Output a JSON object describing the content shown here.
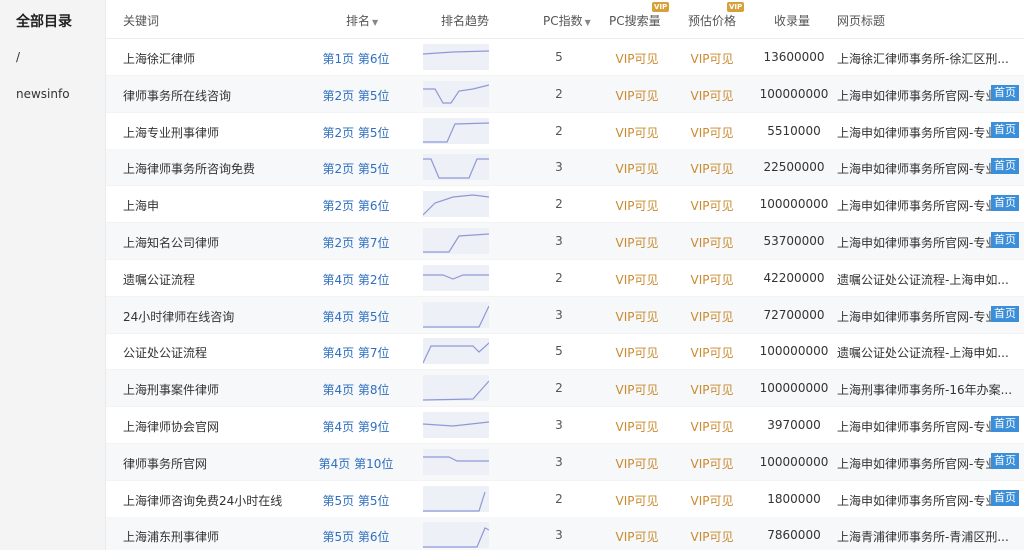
{
  "sidebar": {
    "title": "全部目录",
    "items": [
      "/",
      "newsinfo"
    ]
  },
  "header": {
    "keyword": "关键词",
    "rank": "排名",
    "trend": "排名趋势",
    "pc_index": "PC指数",
    "pc_volume": "PC搜索量",
    "est_price": "预估价格",
    "indexed": "收录量",
    "page_title": "网页标题",
    "vip_badge": "VIP",
    "sort_icon": "sort-down-triangle"
  },
  "colors": {
    "accent_blue": "#2f6fbf",
    "vip_gold": "#c98a2e",
    "badge_blue": "#3b8ed8",
    "spark_stroke": "#8f98d6"
  },
  "rows": [
    {
      "keyword": "上海徐汇律师",
      "rank": "第1页 第6位",
      "pc_index": "5",
      "pc_volume": "VIP可见",
      "est_price": "VIP可见",
      "indexed": "13600000",
      "title": "上海徐汇律师事务所-徐汇区刑...",
      "home_badge": ""
    },
    {
      "keyword": "律师事务所在线咨询",
      "rank": "第2页 第5位",
      "pc_index": "2",
      "pc_volume": "VIP可见",
      "est_price": "VIP可见",
      "indexed": "100000000",
      "title": "上海申如律师事务所官网-专业",
      "home_badge": "首页"
    },
    {
      "keyword": "上海专业刑事律师",
      "rank": "第2页 第5位",
      "pc_index": "2",
      "pc_volume": "VIP可见",
      "est_price": "VIP可见",
      "indexed": "5510000",
      "title": "上海申如律师事务所官网-专业",
      "home_badge": "首页"
    },
    {
      "keyword": "上海律师事务所咨询免费",
      "rank": "第2页 第5位",
      "pc_index": "3",
      "pc_volume": "VIP可见",
      "est_price": "VIP可见",
      "indexed": "22500000",
      "title": "上海申如律师事务所官网-专业",
      "home_badge": "首页"
    },
    {
      "keyword": "上海申",
      "rank": "第2页 第6位",
      "pc_index": "2",
      "pc_volume": "VIP可见",
      "est_price": "VIP可见",
      "indexed": "100000000",
      "title": "上海申如律师事务所官网-专业",
      "home_badge": "首页"
    },
    {
      "keyword": "上海知名公司律师",
      "rank": "第2页 第7位",
      "pc_index": "3",
      "pc_volume": "VIP可见",
      "est_price": "VIP可见",
      "indexed": "53700000",
      "title": "上海申如律师事务所官网-专业",
      "home_badge": "首页"
    },
    {
      "keyword": "遗嘱公证流程",
      "rank": "第4页 第2位",
      "pc_index": "2",
      "pc_volume": "VIP可见",
      "est_price": "VIP可见",
      "indexed": "42200000",
      "title": "遗嘱公证处公证流程-上海申如...",
      "home_badge": ""
    },
    {
      "keyword": "24小时律师在线咨询",
      "rank": "第4页 第5位",
      "pc_index": "3",
      "pc_volume": "VIP可见",
      "est_price": "VIP可见",
      "indexed": "72700000",
      "title": "上海申如律师事务所官网-专业",
      "home_badge": "首页"
    },
    {
      "keyword": "公证处公证流程",
      "rank": "第4页 第7位",
      "pc_index": "5",
      "pc_volume": "VIP可见",
      "est_price": "VIP可见",
      "indexed": "100000000",
      "title": "遗嘱公证处公证流程-上海申如...",
      "home_badge": ""
    },
    {
      "keyword": "上海刑事案件律师",
      "rank": "第4页 第8位",
      "pc_index": "2",
      "pc_volume": "VIP可见",
      "est_price": "VIP可见",
      "indexed": "100000000",
      "title": "上海刑事律师事务所-16年办案...",
      "home_badge": ""
    },
    {
      "keyword": "上海律师协会官网",
      "rank": "第4页 第9位",
      "pc_index": "3",
      "pc_volume": "VIP可见",
      "est_price": "VIP可见",
      "indexed": "3970000",
      "title": "上海申如律师事务所官网-专业",
      "home_badge": "首页"
    },
    {
      "keyword": "律师事务所官网",
      "rank": "第4页 第10位",
      "pc_index": "3",
      "pc_volume": "VIP可见",
      "est_price": "VIP可见",
      "indexed": "100000000",
      "title": "上海申如律师事务所官网-专业",
      "home_badge": "首页"
    },
    {
      "keyword": "上海律师咨询免费24小时在线",
      "rank": "第5页 第5位",
      "pc_index": "2",
      "pc_volume": "VIP可见",
      "est_price": "VIP可见",
      "indexed": "1800000",
      "title": "上海申如律师事务所官网-专业",
      "home_badge": "首页"
    },
    {
      "keyword": "上海浦东刑事律师",
      "rank": "第5页 第6位",
      "pc_index": "3",
      "pc_volume": "VIP可见",
      "est_price": "VIP可见",
      "indexed": "7860000",
      "title": "上海青浦律师事务所-青浦区刑...",
      "home_badge": ""
    }
  ]
}
